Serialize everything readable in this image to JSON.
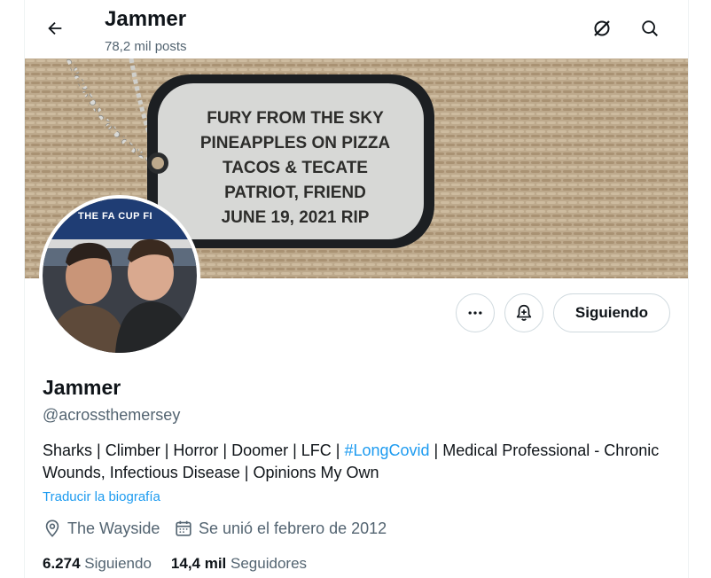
{
  "header": {
    "title": "Jammer",
    "posts_count": "78,2 mil posts"
  },
  "banner": {
    "tag_lines": [
      "FURY FROM THE SKY",
      "PINEAPPLES ON PIZZA",
      "TACOS & TECATE",
      "PATRIOT, FRIEND",
      "JUNE 19, 2021 RIP"
    ],
    "avatar_text": "THE FA CUP FI"
  },
  "actions": {
    "follow_label": "Siguiendo"
  },
  "profile": {
    "name": "Jammer",
    "handle": "@acrossthemersey",
    "bio_part1": "Sharks | Climber | Horror | Doomer | LFC | ",
    "bio_hashtag": "#LongCovid",
    "bio_part2": " | Medical Professional - Chronic Wounds, Infectious Disease | Opinions My Own",
    "translate_label": "Traducir la biografía",
    "location": "The Wayside",
    "joined": "Se unió el febrero de 2012",
    "following_count": "6.274",
    "following_label": "Siguiendo",
    "followers_count": "14,4 mil",
    "followers_label": "Seguidores"
  },
  "colors": {
    "link": "#1d9bf0",
    "secondary_text": "#536471",
    "border": "#cfd9de"
  },
  "icons": [
    "back-arrow-icon",
    "grok-icon",
    "search-icon",
    "more-icon",
    "notification-bell-icon",
    "location-pin-icon",
    "calendar-icon"
  ]
}
